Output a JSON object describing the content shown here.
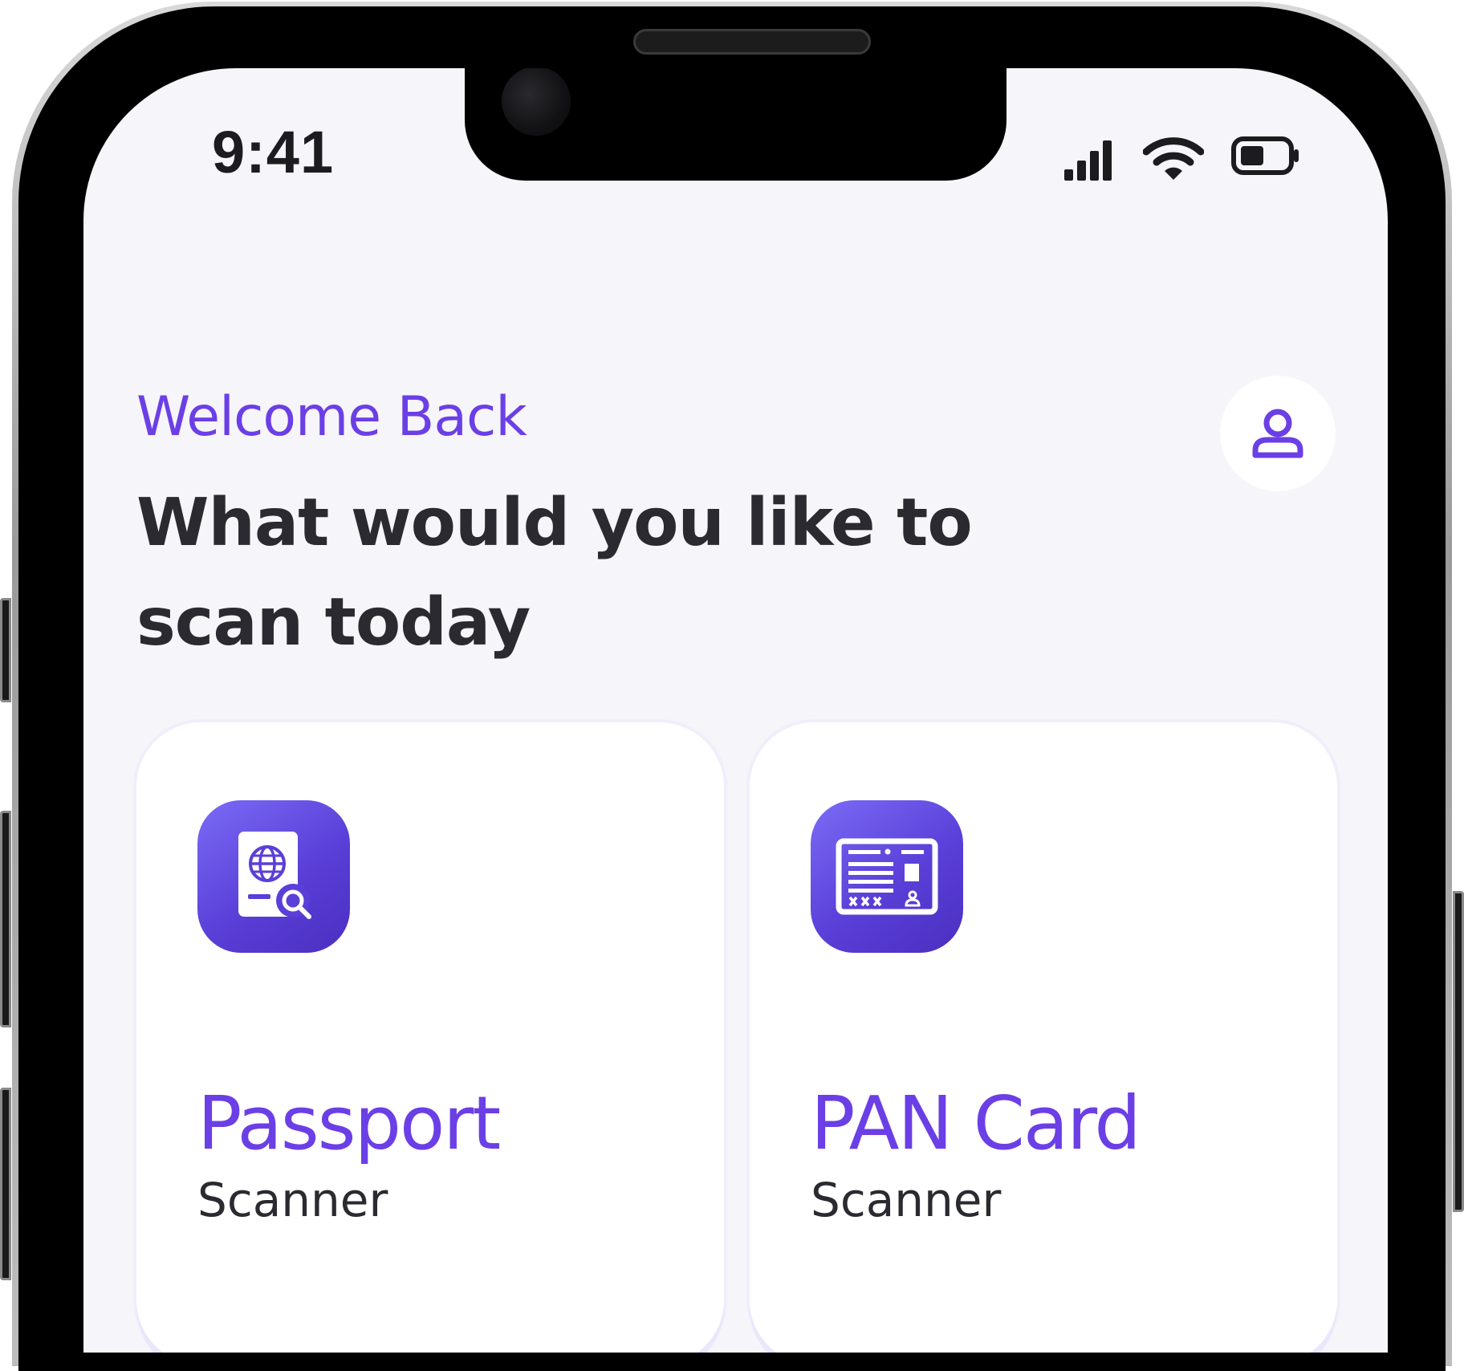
{
  "status_bar": {
    "time": "9:41",
    "icons": [
      "signal-icon",
      "wifi-icon",
      "battery-icon"
    ]
  },
  "header": {
    "welcome": "Welcome Back",
    "headline": "What would you like to scan today",
    "profile_icon": "user-icon"
  },
  "cards": [
    {
      "title": "Passport",
      "subtitle": "Scanner",
      "icon": "passport-scan-icon"
    },
    {
      "title": "PAN Card",
      "subtitle": "Scanner",
      "icon": "id-card-icon"
    }
  ],
  "colors": {
    "accent": "#6b3fe6",
    "background": "#f6f5fa",
    "card": "#ffffff",
    "text_primary": "#2a2a30"
  }
}
